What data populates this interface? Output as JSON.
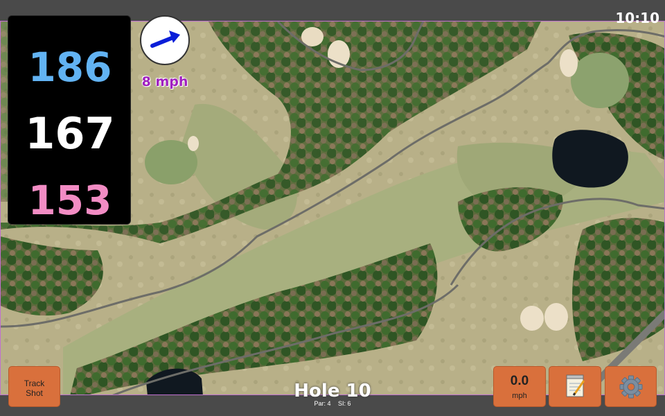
{
  "status": {
    "time": "10:10"
  },
  "distances": {
    "back": "186",
    "middle": "167",
    "front": "153"
  },
  "wind": {
    "speed_label": "8 mph",
    "direction_icon": "arrow-icon"
  },
  "hole": {
    "title": "Hole 10",
    "par_label": "Par: 4",
    "si_label": "SI: 6"
  },
  "buttons": {
    "track_shot_line1": "Track",
    "track_shot_line2": "Shot",
    "speed_value": "0.0",
    "speed_unit": "mph",
    "notes_icon": "notepad-icon",
    "settings_icon": "gear-icon"
  },
  "colors": {
    "back_distance": "#62b3f3",
    "middle_distance": "#ffffff",
    "front_distance": "#f28cc4",
    "button": "#d9703c",
    "wind_text": "#a020c0"
  }
}
